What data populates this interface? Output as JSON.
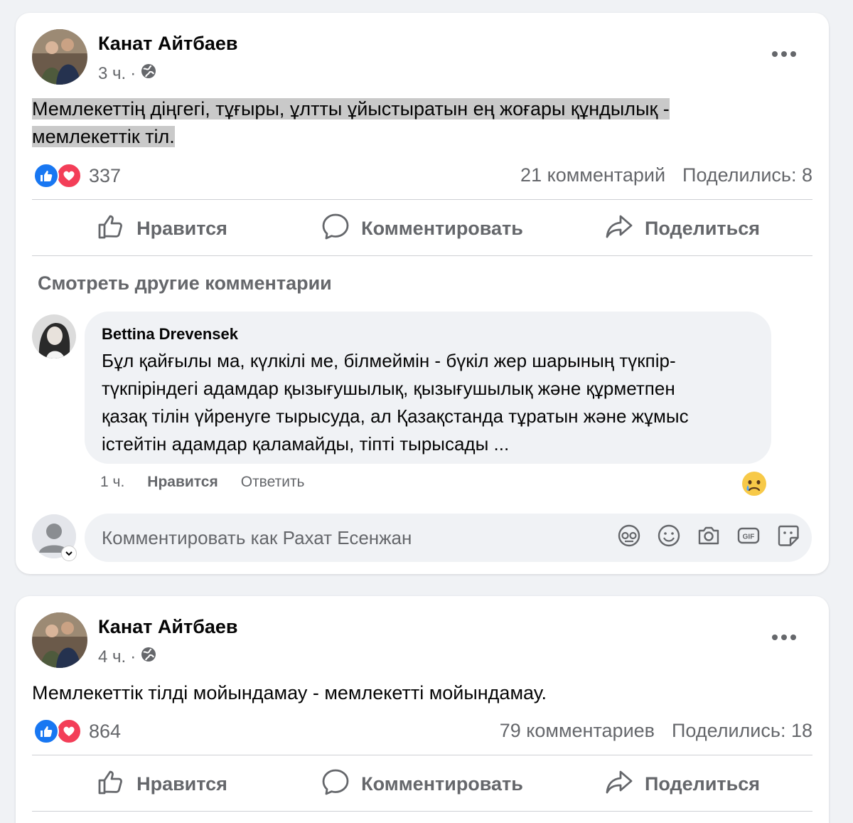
{
  "posts": [
    {
      "author": "Канат Айтбаев",
      "time": "3 ч.",
      "separator": "·",
      "audience_icon": "globe-icon",
      "text_line1": "Мемлекеттің діңгегі, тұғыры, ұлтты ұйыстыратын ең жоғары құндылық -",
      "text_line2": "мемлекеттік тіл.",
      "reaction_count": "337",
      "comments": "21 комментарий",
      "shares": "Поделились: 8",
      "actions": {
        "like": "Нравится",
        "comment": "Комментировать",
        "share": "Поделиться"
      },
      "see_more_comments": "Смотреть другие комментарии",
      "comment": {
        "name": "Bettina Drevensek",
        "line1": "Бұл қайғылы ма, күлкілі ме, білмеймін - бүкіл жер шарының түкпір-",
        "line2": "түкпіріндегі адамдар қызығушылық, қызығушылық және құрметпен",
        "line3": "қазақ тілін үйренуге тырысуда, ал Қазақстанда тұратын және жұмыс",
        "line4": "істейтін адамдар қаламайды, тіпті тырысады ...",
        "time": "1 ч.",
        "like": "Нравится",
        "reply": "Ответить",
        "reaction_icon": "sad-reaction-icon"
      },
      "comment_placeholder": "Комментировать как Рахат Есенжан"
    },
    {
      "author": "Канат Айтбаев",
      "time": "4 ч.",
      "separator": "·",
      "audience_icon": "globe-icon",
      "text_line1": "Мемлекеттік тілді мойындамау - мемлекетті мойындамау.",
      "reaction_count": "864",
      "comments": "79 комментариев",
      "shares": "Поделились: 18",
      "actions": {
        "like": "Нравится",
        "comment": "Комментировать",
        "share": "Поделиться"
      }
    }
  ],
  "colors": {
    "like_blue": "#1877f2",
    "love_red": "#f33e58",
    "secondary_text": "#65676b",
    "highlight": "#c9c9c9"
  }
}
